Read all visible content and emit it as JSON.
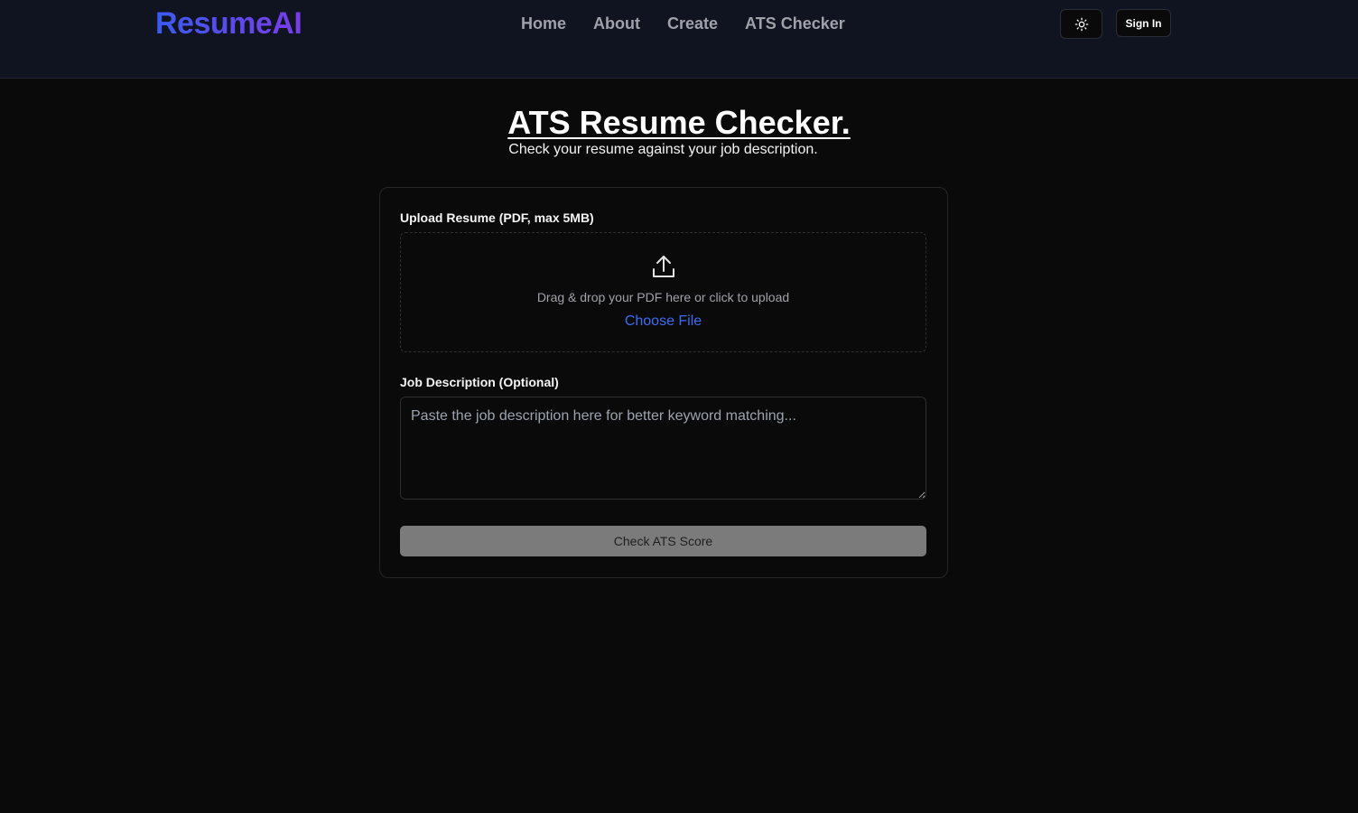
{
  "header": {
    "logo": "ResumeAI",
    "nav": [
      "Home",
      "About",
      "Create",
      "ATS Checker"
    ],
    "theme_toggle_icon": "sun-icon",
    "signin_label": "Sign In"
  },
  "page": {
    "title": "ATS Resume Checker.",
    "subtitle": "Check your resume against your job description."
  },
  "form": {
    "upload_label": "Upload Resume (PDF, max 5MB)",
    "upload_icon": "upload-icon",
    "drop_text": "Drag & drop your PDF here or click to upload",
    "choose_file": "Choose File",
    "jd_label": "Job Description (Optional)",
    "jd_placeholder": "Paste the job description here for better keyword matching...",
    "jd_value": "",
    "submit_label": "Check ATS Score"
  },
  "colors": {
    "logo_gradient_start": "#3b5bf0",
    "logo_gradient_end": "#7a3ce8",
    "link": "#3b6cf5",
    "button_disabled": "#7b7b7b"
  }
}
